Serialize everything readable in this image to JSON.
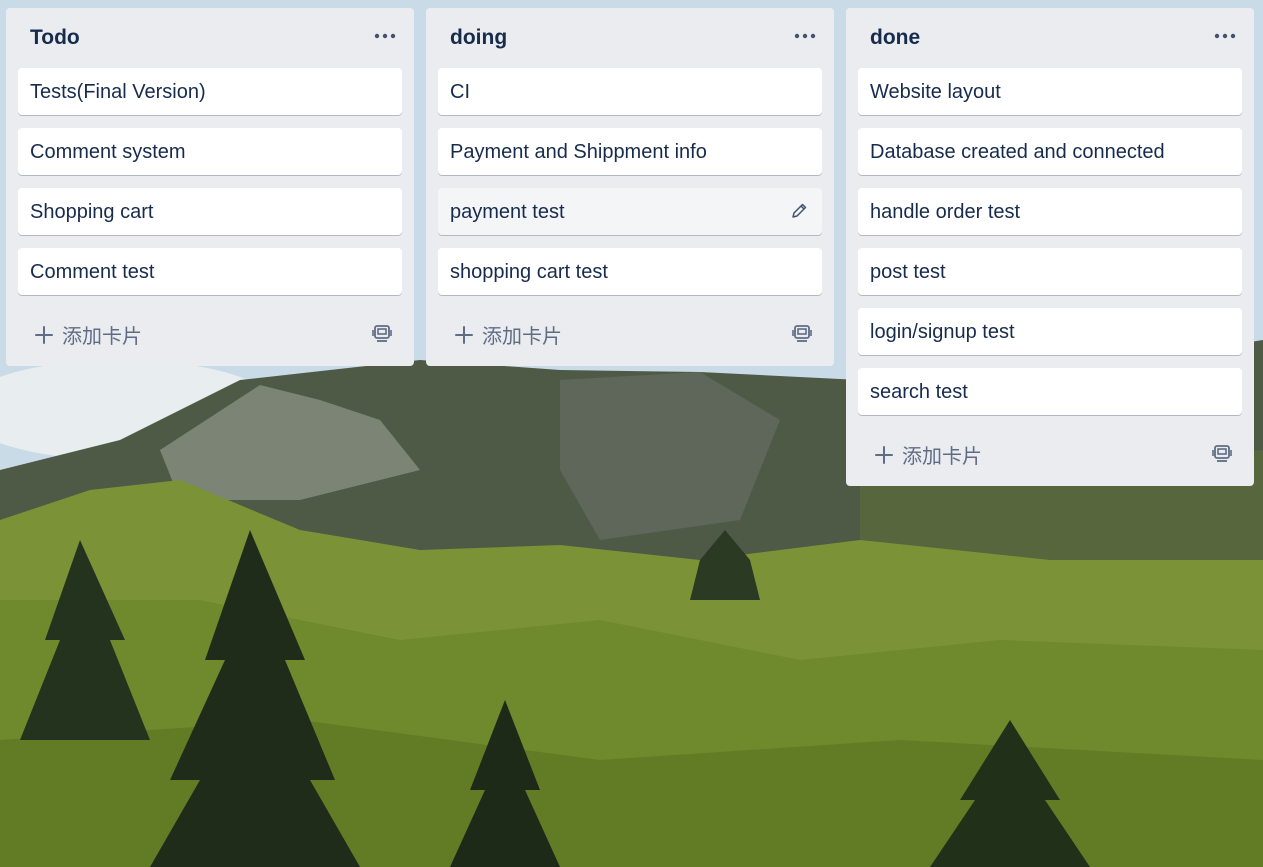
{
  "lists": [
    {
      "title": "Todo",
      "cards": [
        "Tests(Final Version)",
        "Comment system",
        "Shopping cart",
        "Comment test"
      ],
      "add_label": "添加卡片"
    },
    {
      "title": "doing",
      "cards": [
        "CI",
        "Payment and Shippment info",
        "payment test",
        "shopping cart test"
      ],
      "add_label": "添加卡片"
    },
    {
      "title": "done",
      "cards": [
        "Website layout",
        "Database created and connected",
        "handle order test",
        "post test",
        "login/signup test",
        "search test"
      ],
      "add_label": "添加卡片"
    }
  ],
  "icons": {
    "list_menu": "more-horizontal-icon",
    "card_edit": "pencil-icon",
    "add": "plus-icon",
    "template": "card-template-icon"
  },
  "colors": {
    "list_bg": "#ebecf0",
    "card_bg": "#ffffff",
    "text": "#172b4d",
    "muted_text": "#5e6c84"
  }
}
